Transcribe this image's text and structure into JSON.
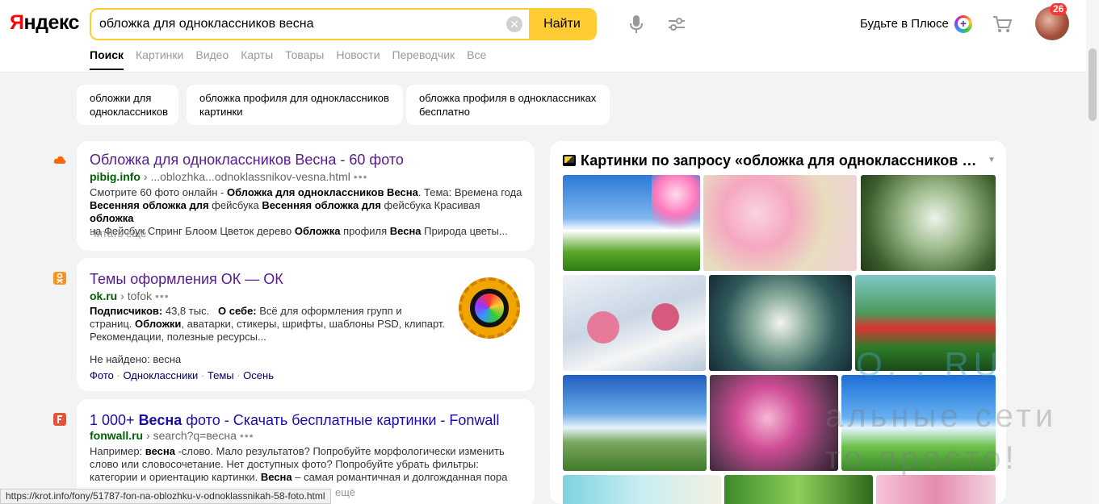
{
  "header": {
    "logo_first": "Я",
    "logo_rest": "ндекс",
    "search_value": "обложка для одноклассников весна",
    "clear_label": "✕",
    "find_label": "Найти",
    "plus_label": "Будьте в Плюсе",
    "notifications_count": "26"
  },
  "tabs": [
    "Поиск",
    "Картинки",
    "Видео",
    "Карты",
    "Товары",
    "Новости",
    "Переводчик",
    "Все"
  ],
  "suggestions": [
    {
      "line1": "обложки для",
      "line2": "одноклассников"
    },
    {
      "line1": "обложка профиля для одноклассников",
      "line2": "картинки"
    },
    {
      "line1": "обложка профиля в одноклассниках",
      "line2": "бесплатно"
    }
  ],
  "results": [
    {
      "title_a": "Обложка для одноклассников Весна",
      "title_b": " - 60 фото",
      "domain": "pibig.info",
      "path": "...oblozhka...odnoklassnikov-vesna.html",
      "dots": "•••",
      "snippet_1a": "Смотрите 60 фото онлайн - ",
      "snippet_1b": "Обложка для одноклассников Весна",
      "snippet_1c": ". Тема: Времена года",
      "snippet_2a": "Весенняя обложка для",
      "snippet_2b": " фейсбука ",
      "snippet_2c": "Весенняя обложка для",
      "snippet_2d": " фейсбука Красивая ",
      "snippet_2e": "обложка",
      "snippet_3a": "на Фейсбук Спринг Блоом Цветок дерево ",
      "snippet_3b": "Обложка",
      "snippet_3c": " профиля ",
      "snippet_3d": "Весна",
      "snippet_3e": " Природа цветы...",
      "more": "Читать ещё"
    },
    {
      "title": "Темы оформления ОК — ОК",
      "domain": "ok.ru",
      "path": "tofok",
      "dots": "•••",
      "subs_label": "Подписчиков:",
      "subs_value": " 43,8 тыс.",
      "about_label": "О себе:",
      "about_value": " Всё для оформления групп и",
      "line2a": "страниц. ",
      "line2b": "Обложки",
      "line2c": ", аватарки, стикеры, шрифты, шаблоны PSD, клипарт.",
      "line3": "Рекомендации, полезные ресурсы...",
      "not_found": "Не найдено: весна",
      "links": [
        "Фото",
        "Одноклассники",
        "Темы",
        "Осень"
      ],
      "link_sep": " · "
    },
    {
      "title_a": "1 000+ ",
      "title_b": "Весна",
      "title_c": " фото - Скачать бесплатные картинки - Fonwall",
      "domain": "fonwall.ru",
      "path": "search?q=весна",
      "dots": "•••",
      "line1a": "Например: ",
      "line1b": "весна",
      "line1c": " -слово. Мало результатов? Попробуйте морфологически изменить",
      "line2": "слово или словосочетание. Нет доступных фото? Попробуйте убрать фильтры:",
      "line3a": "категории и ориентацию картинки. ",
      "line3b": "Весна",
      "line3c": " – самая романтичная и долгожданная пора",
      "more": "ещё"
    }
  ],
  "images": {
    "title": "Картинки по запросу «обложка для одноклассников ве...",
    "caret": "▼"
  },
  "watermark": {
    "line1": "О.  . RU",
    "line2": "альные сети",
    "line3": "то просто!"
  },
  "status_url": "https://krot.info/fony/51787-fon-na-oblozhku-v-odnoklassnikah-58-foto.html"
}
